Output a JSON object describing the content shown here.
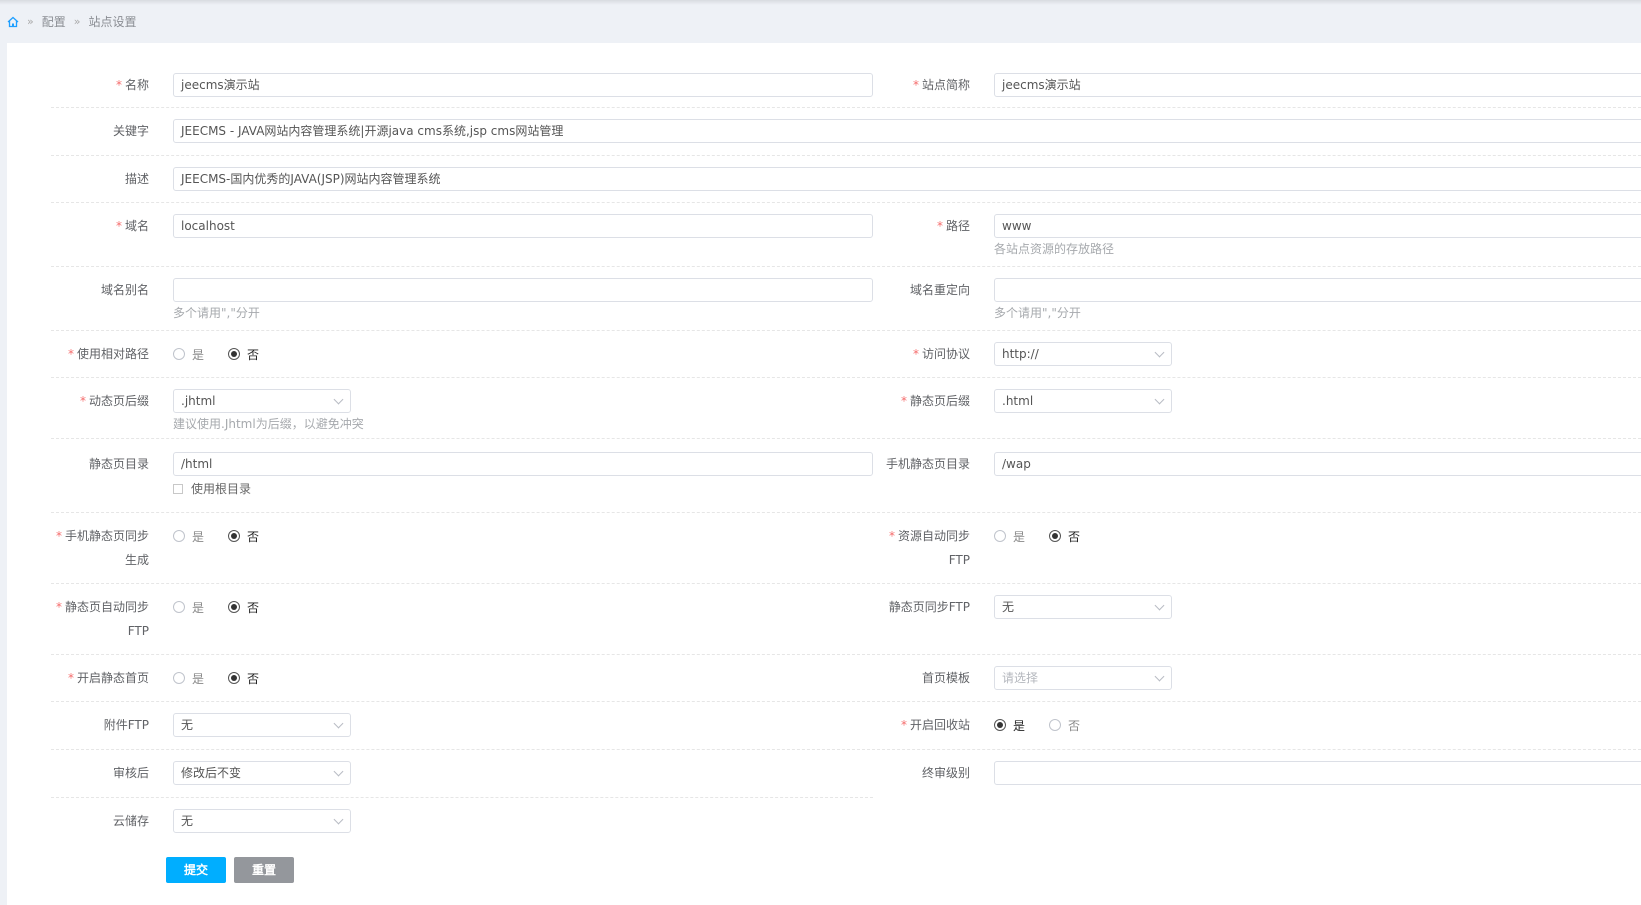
{
  "breadcrumb": {
    "home_icon": "home-icon",
    "items": [
      "配置",
      "站点设置"
    ]
  },
  "fields": {
    "name": {
      "label": "名称",
      "value": "jeecms演示站"
    },
    "short_name": {
      "label": "站点简称",
      "value": "jeecms演示站"
    },
    "keywords": {
      "label": "关键字",
      "value": "JEECMS - JAVA网站内容管理系统|开源java cms系统,jsp cms网站管理"
    },
    "description": {
      "label": "描述",
      "value": "JEECMS-国内优秀的JAVA(JSP)网站内容管理系统"
    },
    "domain": {
      "label": "域名",
      "value": "localhost"
    },
    "path": {
      "label": "路径",
      "value": "www",
      "hint": "各站点资源的存放路径"
    },
    "domain_alias": {
      "label": "域名别名",
      "value": "",
      "hint": "多个请用\",\"分开"
    },
    "domain_redirect": {
      "label": "域名重定向",
      "value": "",
      "hint": "多个请用\",\"分开"
    },
    "relative_path": {
      "label": "使用相对路径",
      "yes": "是",
      "no": "否",
      "selected": "否"
    },
    "protocol": {
      "label": "访问协议",
      "value": "http://"
    },
    "dynamic_suffix": {
      "label": "动态页后缀",
      "value": ".jhtml",
      "hint": "建议使用.Jhtml为后缀，以避免冲突"
    },
    "static_suffix": {
      "label": "静态页后缀",
      "value": ".html"
    },
    "static_dir": {
      "label": "静态页目录",
      "value": "/html",
      "checkbox": "使用根目录",
      "checked": false
    },
    "mobile_static_dir": {
      "label": "手机静态页目录",
      "value": "/wap"
    },
    "mobile_sync": {
      "label_1": "手机静态页同步",
      "label_2": "生成",
      "yes": "是",
      "no": "否",
      "selected": "否"
    },
    "resource_sync": {
      "label_1": "资源自动同步",
      "label_2": "FTP",
      "yes": "是",
      "no": "否",
      "selected": "否"
    },
    "static_sync_ftp": {
      "label_1": "静态页自动同步",
      "label_2": "FTP",
      "yes": "是",
      "no": "否",
      "selected": "否"
    },
    "static_ftp": {
      "label": "静态页同步FTP",
      "value": "无"
    },
    "static_index": {
      "label": "开启静态首页",
      "yes": "是",
      "no": "否",
      "selected": "否"
    },
    "index_template": {
      "label": "首页模板",
      "placeholder": "请选择"
    },
    "attachment_ftp": {
      "label": "附件FTP",
      "value": "无"
    },
    "recycle_bin": {
      "label": "开启回收站",
      "yes": "是",
      "no": "否",
      "selected": "是"
    },
    "after_review": {
      "label": "审核后",
      "value": "修改后不变"
    },
    "final_review_level": {
      "label": "终审级别",
      "value": ""
    },
    "cloud_storage": {
      "label": "云储存",
      "value": "无"
    }
  },
  "buttons": {
    "submit": "提交",
    "reset": "重置"
  },
  "colors": {
    "primary": "#00aeff",
    "reset": "#94979c",
    "required": "#f56c6c"
  }
}
